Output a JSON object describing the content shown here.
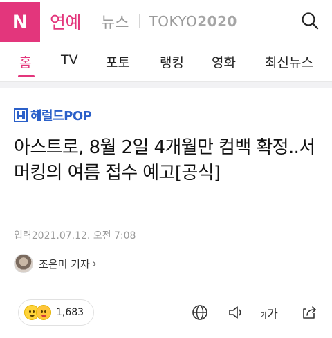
{
  "header": {
    "logo": "N",
    "section": "연예",
    "news": "뉴스",
    "olympics_prefix": "TOKYO",
    "olympics_year": "2020"
  },
  "tabs": [
    {
      "label": "홈",
      "active": true
    },
    {
      "label": "TV",
      "active": false
    },
    {
      "label": "포토",
      "active": false
    },
    {
      "label": "랭킹",
      "active": false
    },
    {
      "label": "영화",
      "active": false
    },
    {
      "label": "최신뉴스",
      "active": false
    }
  ],
  "article": {
    "press": "헤럴드POP",
    "title": "아스트로, 8월 2일 4개월만 컴백 확정..서머킹의 여름 접수 예고[공식]",
    "date": "입력2021.07.12. 오전 7:08",
    "reporter": "조은미 기자",
    "reporter_chevron": "›"
  },
  "toolbar": {
    "reaction_count": "1,683",
    "fontsize_small": "가",
    "fontsize_large": "가"
  },
  "colors": {
    "accent": "#e3367c",
    "press_blue": "#2b60c9"
  }
}
